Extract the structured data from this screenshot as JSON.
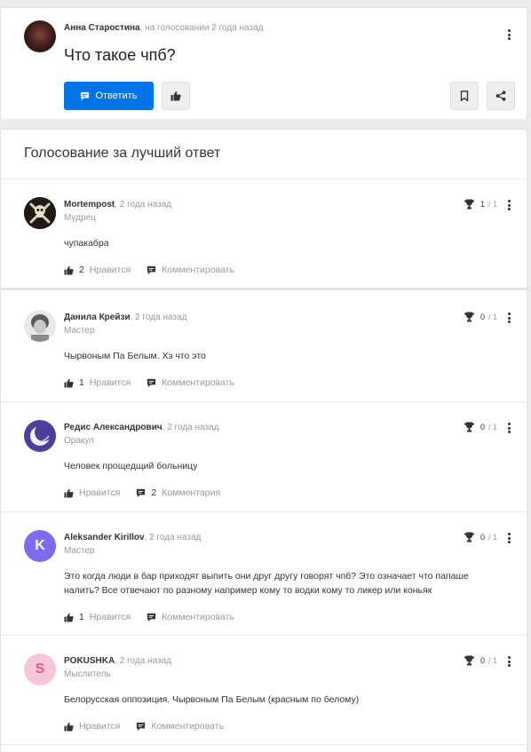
{
  "question": {
    "author": "Анна Старостина",
    "meta_suffix": ", на голосовании 2 года назад",
    "title": "Что такое чпб?",
    "answer_button": "Ответить"
  },
  "voting": {
    "title": "Голосование за лучший ответ"
  },
  "answers": [
    {
      "author": "Mortempost",
      "time": ", 2 года назад",
      "rank": "Мудрец",
      "text": "чупакабра",
      "votes": "1",
      "votes_total": "/ 1",
      "likes": "2",
      "like_label": "Нравится",
      "comments": "",
      "comment_label": "Комментировать"
    },
    {
      "author": "Данила Крейзи",
      "time": ", 2 года назад",
      "rank": "Мастер",
      "text": "Чырвоным Па Белым. Хз что это",
      "votes": "0",
      "votes_total": "/ 1",
      "likes": "1",
      "like_label": "Нравится",
      "comments": "",
      "comment_label": "Комментировать"
    },
    {
      "author": "Редис Александрович",
      "time": ", 2 года назад",
      "rank": "Оракул",
      "text": "Человек прощедщий больницу",
      "votes": "0",
      "votes_total": "/ 1",
      "likes": "",
      "like_label": "Нравится",
      "comments": "2",
      "comment_label": "Комментария"
    },
    {
      "author": "Aleksander Kirillov",
      "time": ", 2 года назад",
      "rank": "Мастер",
      "text_line1": "Это когда люди в бар приходят выпить они друг другу говорят чпб? Это означает что папаше",
      "text_line2": "налить? Все отвечают по разному например кому то водки кому то ликер или коньяк",
      "votes": "0",
      "votes_total": "/ 1",
      "likes": "1",
      "like_label": "Нравится",
      "comments": "",
      "comment_label": "Комментировать",
      "avatar_letter": "K"
    },
    {
      "author": "POKUSHKA",
      "time": ", 2 года назад",
      "rank": "Мыслитель",
      "text": "Белорусская оппозиция. Чырвоным Па Белым (красным по белому)",
      "votes": "0",
      "votes_total": "/ 1",
      "likes": "",
      "like_label": "Нравится",
      "comments": "",
      "comment_label": "Комментировать",
      "avatar_letter": "S"
    }
  ],
  "colors": {
    "accent": "#0073e6",
    "avatar_k": "#7b6cf0",
    "avatar_s": "#f7c6d9"
  }
}
